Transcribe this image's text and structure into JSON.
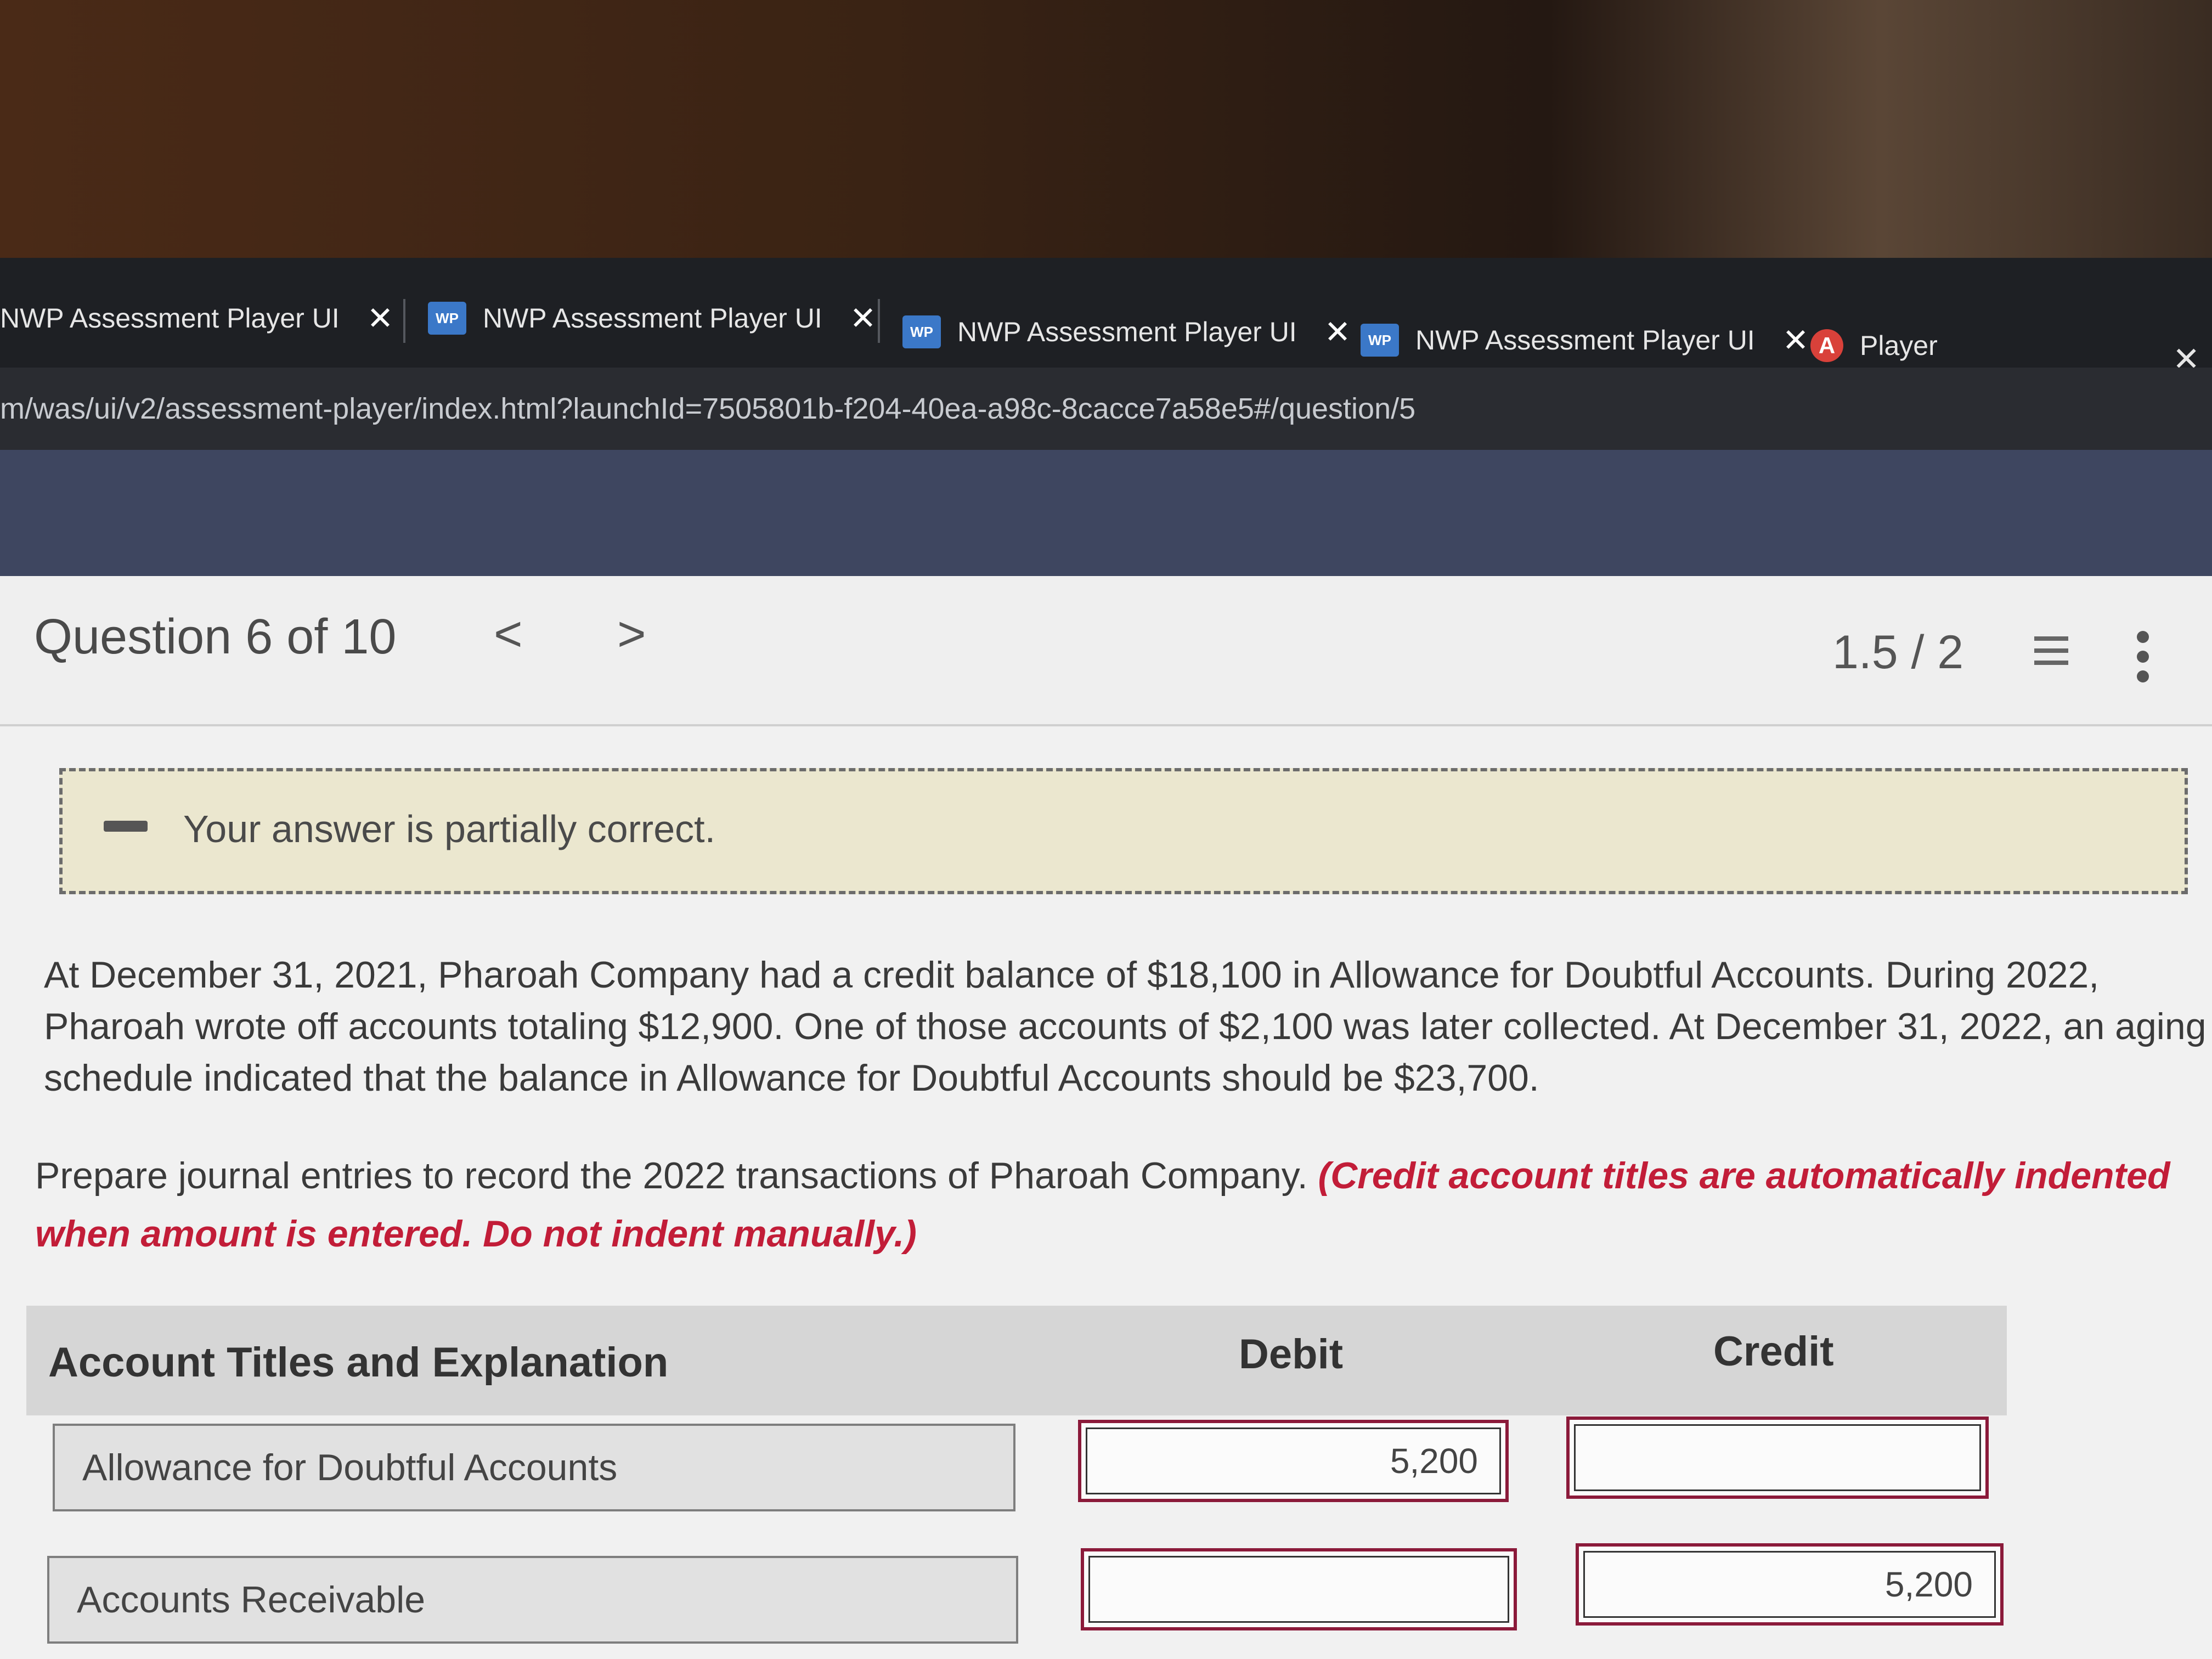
{
  "browser": {
    "tabs": [
      {
        "label": "NWP Assessment Player UI",
        "favicon": "",
        "close": "✕"
      },
      {
        "label": "NWP Assessment Player UI",
        "favicon": "WP",
        "close": "✕"
      },
      {
        "label": "NWP Assessment Player UI",
        "favicon": "WP",
        "close": "✕"
      },
      {
        "label": "NWP Assessment Player UI",
        "favicon": "WP",
        "close": "✕"
      },
      {
        "label": "Player",
        "favicon": "A"
      }
    ],
    "window_close": "✕",
    "url": "m/was/ui/v2/assessment-player/index.html?launchId=7505801b-f204-40ea-a98c-8cacce7a58e5#/question/5"
  },
  "question_header": {
    "title": "Question 6 of 10",
    "prev": "<",
    "next": ">",
    "score": "1.5 / 2"
  },
  "feedback": {
    "message": "Your answer is partially correct.",
    "color": "#ebe7cf"
  },
  "problem": {
    "text": "At December 31, 2021, Pharoah Company had a credit balance of $18,100 in Allowance for Doubtful Accounts. During 2022, Pharoah wrote off accounts totaling $12,900. One of those accounts of $2,100 was later collected. At December 31, 2022, an aging schedule indicated that the balance in Allowance for Doubtful Accounts should be $23,700.",
    "instruction": "Prepare journal entries to record the 2022 transactions of Pharoah Company.",
    "instruction_note": "(Credit account titles are automatically indented when amount is entered. Do not indent manually.)",
    "accent_color": "#c21d38"
  },
  "journal": {
    "headers": {
      "account": "Account Titles and Explanation",
      "debit": "Debit",
      "credit": "Credit"
    },
    "rows": [
      {
        "account": "Allowance for Doubtful Accounts",
        "debit": "5,200",
        "credit": ""
      },
      {
        "account": "Accounts Receivable",
        "debit": "",
        "credit": "5,200"
      }
    ]
  }
}
